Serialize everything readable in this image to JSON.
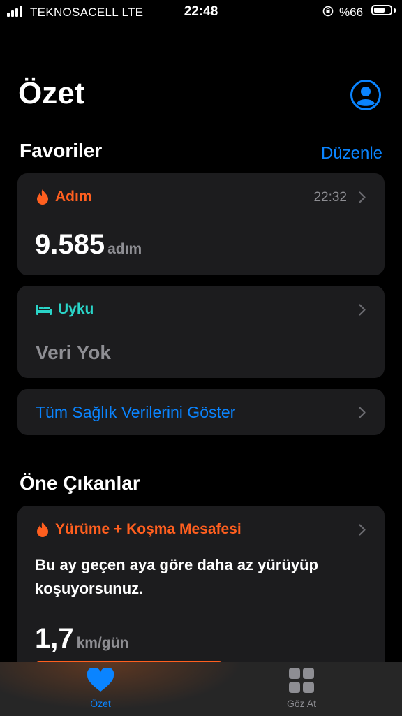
{
  "status_bar": {
    "carrier": "TEKNOSACELL  LTE",
    "time": "22:48",
    "battery": "%66",
    "battery_level": 0.66
  },
  "header": {
    "title": "Özet"
  },
  "favorites": {
    "title": "Favoriler",
    "edit_label": "Düzenle",
    "steps": {
      "label": "Adım",
      "time": "22:32",
      "value": "9.585",
      "unit": "adım"
    },
    "sleep": {
      "label": "Uyku",
      "value": "Veri Yok"
    },
    "show_all": "Tüm Sağlık Verilerini Göster"
  },
  "highlights": {
    "title": "Öne Çıkanlar",
    "card": {
      "label": "Yürüme + Koşma Mesafesi",
      "message": "Bu ay geçen aya göre daha az yürüyüp koşuyorsunuz.",
      "value": "1,7",
      "unit": "km/gün"
    }
  },
  "tabs": [
    {
      "label": "Özet",
      "icon": "heart-icon",
      "active": true
    },
    {
      "label": "Göz At",
      "icon": "grid-icon",
      "active": false
    }
  ],
  "colors": {
    "accent": "#0a84ff",
    "activity": "#ff5f1f",
    "sleep": "#2ad4c8",
    "card": "#1c1c1e"
  }
}
